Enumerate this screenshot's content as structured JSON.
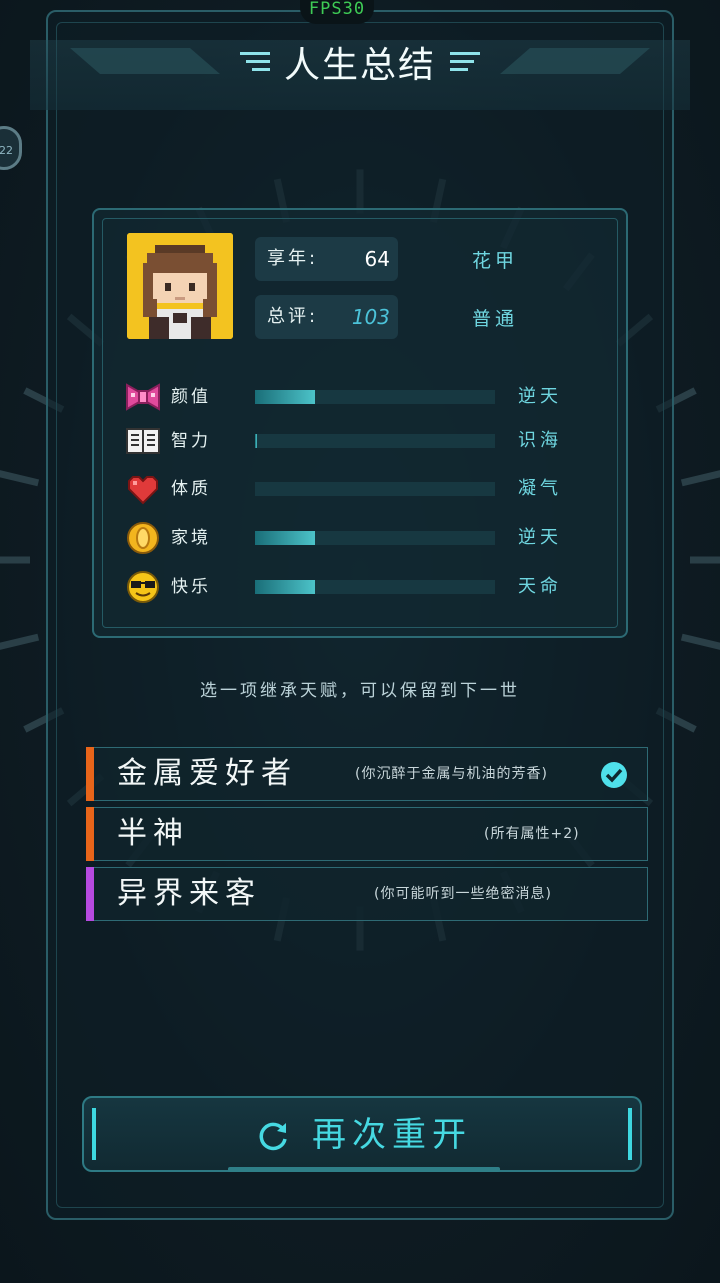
{
  "hud": {
    "fps": "FPS30",
    "side_badge": "22"
  },
  "header": {
    "title": "人生总结"
  },
  "summary": {
    "age_label": "享年:",
    "age_value": "64",
    "age_rank": "花甲",
    "score_label": "总评:",
    "score_value": "103",
    "score_rank": "普通"
  },
  "attributes": [
    {
      "name": "颜值",
      "icon": "bow-icon",
      "level": "逆天",
      "fill": 0.25
    },
    {
      "name": "智力",
      "icon": "book-icon",
      "level": "识海",
      "fill": 0.01
    },
    {
      "name": "体质",
      "icon": "heart-icon",
      "level": "凝气",
      "fill": 0.0
    },
    {
      "name": "家境",
      "icon": "coin-icon",
      "level": "逆天",
      "fill": 0.25
    },
    {
      "name": "快乐",
      "icon": "sunglasses-face-icon",
      "level": "天命",
      "fill": 0.25
    }
  ],
  "inherit": {
    "hint": "选一项继承天赋，可以保留到下一世",
    "options": [
      {
        "name": "金属爱好者",
        "desc": "(你沉醉于金属与机油的芳香)",
        "color": "#e8651a",
        "selected": true
      },
      {
        "name": "半神",
        "desc": "(所有属性+2)",
        "color": "#e8651a",
        "selected": false
      },
      {
        "name": "异界来客",
        "desc": "(你可能听到一些绝密消息)",
        "color": "#b64ae0",
        "selected": false
      }
    ]
  },
  "actions": {
    "restart_label": "再次重开"
  },
  "colors": {
    "accent": "#46d9e2",
    "score": "#4cc3d9",
    "bar": "#4cc3c9"
  }
}
